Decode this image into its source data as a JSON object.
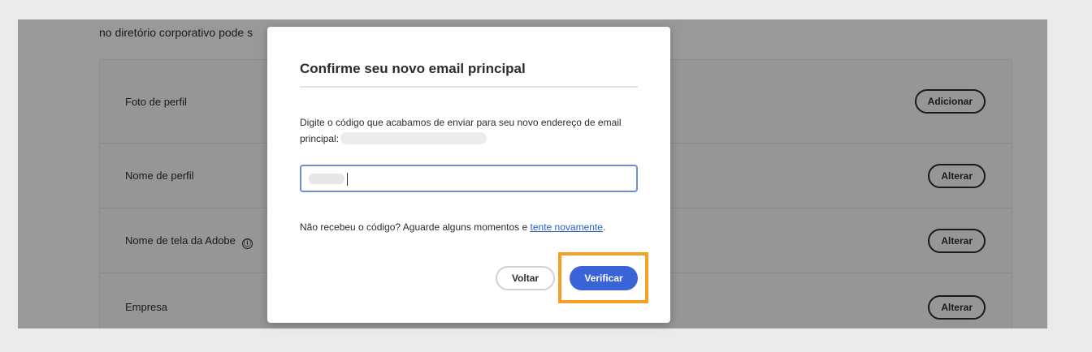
{
  "page": {
    "intro_text": "no diretório corporativo pode s",
    "rows": [
      {
        "label": "Foto de perfil",
        "action": "Adicionar"
      },
      {
        "label": "Nome de perfil",
        "action": "Alterar"
      },
      {
        "label": "Nome de tela da Adobe",
        "action": "Alterar",
        "info_icon": "ⓘ"
      },
      {
        "label": "Empresa",
        "action": "Alterar"
      }
    ]
  },
  "modal": {
    "title": "Confirme seu novo email principal",
    "description": "Digite o código que acabamos de enviar para seu novo endereço de email principal:",
    "resend_prefix": "Não recebeu o código? Aguarde alguns momentos e ",
    "resend_link": "tente novamente",
    "resend_suffix": ".",
    "back_label": "Voltar",
    "verify_label": "Verificar"
  },
  "colors": {
    "accent": "#3b63d8",
    "highlight": "#f4a024",
    "link": "#2b5fc7",
    "input_border": "#6e8fd6"
  }
}
